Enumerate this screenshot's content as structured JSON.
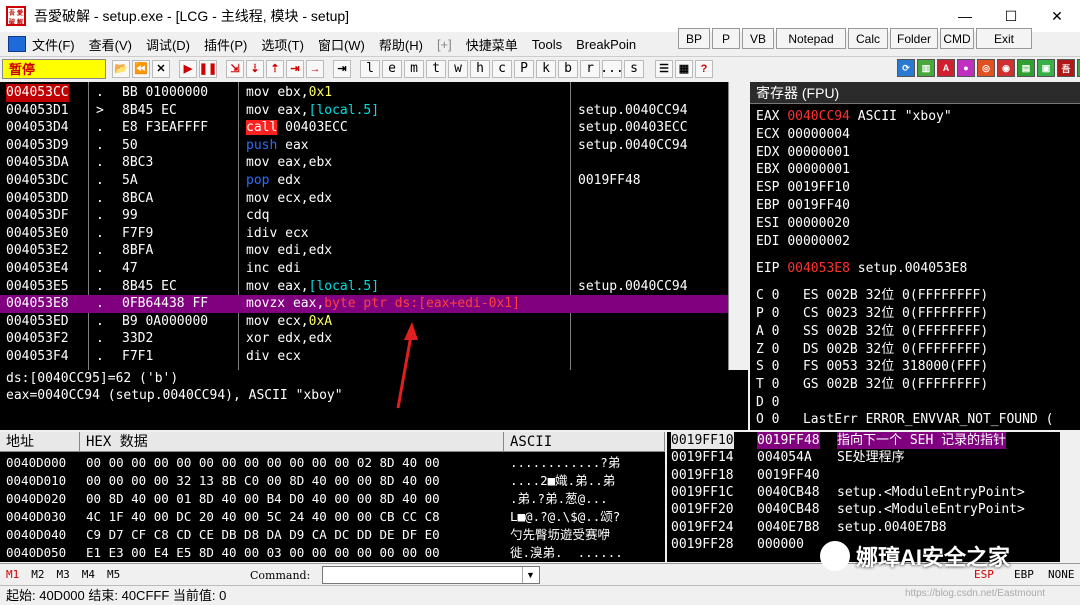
{
  "window": {
    "title": "吾愛破解 - setup.exe - [LCG -  主线程, 模块 - setup]",
    "icon_text": [
      "吾",
      "愛",
      "破",
      "解"
    ]
  },
  "menu": {
    "items": [
      "文件(F)",
      "查看(V)",
      "调试(D)",
      "插件(P)",
      "选项(T)",
      "窗口(W)",
      "帮助(H)",
      "[+]",
      "快捷菜单",
      "Tools",
      "BreakPoin"
    ],
    "quick_buttons": [
      "BP",
      "P",
      "VB",
      "Notepad",
      "Calc",
      "Folder",
      "CMD",
      "Exit"
    ]
  },
  "toolbar": {
    "status": "暂停",
    "letters": [
      "l",
      "e",
      "m",
      "t",
      "w",
      "h",
      "c",
      "P",
      "k",
      "b",
      "r",
      "...",
      "s"
    ],
    "nav_icons": [
      "⏪",
      "✕",
      "▶",
      "❚❚",
      "⇲",
      "⇣",
      "⇡",
      "⇥",
      "→"
    ]
  },
  "disasm": {
    "rows": [
      {
        "addr": "004053CC",
        "mark": ".",
        "hex": "BB 01000000",
        "mn": "mov",
        "ops": "ebx,",
        "imm": "0x1",
        "cmt": ""
      },
      {
        "addr": "004053D1",
        "mark": ">",
        "hex": "8B45 EC",
        "mn": "mov",
        "ops": "eax,",
        "imm": "[local.5]",
        "cmt": "setup.0040CC94"
      },
      {
        "addr": "004053D4",
        "mark": ".",
        "hex": "E8 F3EAFFFF",
        "mn": "call",
        "ops": "00403ECC",
        "imm": "",
        "cmt": "setup.00403ECC"
      },
      {
        "addr": "004053D9",
        "mark": ".",
        "hex": "50",
        "mn": "push",
        "ops": "eax",
        "imm": "",
        "cmt": "setup.0040CC94"
      },
      {
        "addr": "004053DA",
        "mark": ".",
        "hex": "8BC3",
        "mn": "mov",
        "ops": "eax,ebx",
        "imm": "",
        "cmt": ""
      },
      {
        "addr": "004053DC",
        "mark": ".",
        "hex": "5A",
        "mn": "pop",
        "ops": "edx",
        "imm": "",
        "cmt": "0019FF48"
      },
      {
        "addr": "004053DD",
        "mark": ".",
        "hex": "8BCA",
        "mn": "mov",
        "ops": "ecx,edx",
        "imm": "",
        "cmt": ""
      },
      {
        "addr": "004053DF",
        "mark": ".",
        "hex": "99",
        "mn": "cdq",
        "ops": "",
        "imm": "",
        "cmt": ""
      },
      {
        "addr": "004053E0",
        "mark": ".",
        "hex": "F7F9",
        "mn": "idiv",
        "ops": "ecx",
        "imm": "",
        "cmt": ""
      },
      {
        "addr": "004053E2",
        "mark": ".",
        "hex": "8BFA",
        "mn": "mov",
        "ops": "edi,edx",
        "imm": "",
        "cmt": ""
      },
      {
        "addr": "004053E4",
        "mark": ".",
        "hex": "47",
        "mn": "inc",
        "ops": "edi",
        "imm": "",
        "cmt": ""
      },
      {
        "addr": "004053E5",
        "mark": ".",
        "hex": "8B45 EC",
        "mn": "mov",
        "ops": "eax,",
        "imm": "[local.5]",
        "cmt": "setup.0040CC94"
      },
      {
        "addr": "004053E8",
        "mark": ".",
        "hex": "0FB64438 FF",
        "mn": "movzx",
        "ops": "eax,",
        "imm": "byte ptr ds:[eax+edi-0x1]",
        "cmt": ""
      },
      {
        "addr": "004053ED",
        "mark": ".",
        "hex": "B9 0A000000",
        "mn": "mov",
        "ops": "ecx,",
        "imm": "0xA",
        "cmt": ""
      },
      {
        "addr": "004053F2",
        "mark": ".",
        "hex": "33D2",
        "mn": "xor",
        "ops": "edx,edx",
        "imm": "",
        "cmt": ""
      },
      {
        "addr": "004053F4",
        "mark": ".",
        "hex": "F7F1",
        "mn": "div",
        "ops": "ecx",
        "imm": "",
        "cmt": ""
      }
    ]
  },
  "info": {
    "line1": "ds:[0040CC95]=62 ('b')",
    "line2": "eax=0040CC94 (setup.0040CC94), ASCII \"xboy\""
  },
  "registers": {
    "title": "寄存器 (FPU)",
    "gp": [
      {
        "name": "EAX",
        "value": "0040CC94",
        "note": "ASCII \"xboy\"",
        "changed": true
      },
      {
        "name": "ECX",
        "value": "00000004",
        "note": "",
        "changed": false
      },
      {
        "name": "EDX",
        "value": "00000001",
        "note": "",
        "changed": false
      },
      {
        "name": "EBX",
        "value": "00000001",
        "note": "",
        "changed": false
      },
      {
        "name": "ESP",
        "value": "0019FF10",
        "note": "",
        "changed": false
      },
      {
        "name": "EBP",
        "value": "0019FF40",
        "note": "",
        "changed": false
      },
      {
        "name": "ESI",
        "value": "00000020",
        "note": "",
        "changed": false
      },
      {
        "name": "EDI",
        "value": "00000002",
        "note": "",
        "changed": false
      }
    ],
    "eip": {
      "name": "EIP",
      "value": "004053E8",
      "note": "setup.004053E8"
    },
    "flags": [
      "C 0   ES 002B 32位 0(FFFFFFFF)",
      "P 0   CS 0023 32位 0(FFFFFFFF)",
      "A 0   SS 002B 32位 0(FFFFFFFF)",
      "Z 0   DS 002B 32位 0(FFFFFFFF)",
      "S 0   FS 0053 32位 318000(FFF)",
      "T 0   GS 002B 32位 0(FFFFFFFF)",
      "D 0",
      "O 0   LastErr ERROR_ENVVAR_NOT_FOUND ("
    ]
  },
  "dump": {
    "headers": [
      "地址",
      "HEX 数据",
      "ASCII"
    ],
    "rows": [
      {
        "addr": "0040D000",
        "hex": "00 00 00 00 00 00 00 00 00 00 00 00 02 8D 40 00",
        "ascii": "............?弟"
      },
      {
        "addr": "0040D010",
        "hex": "00 00 00 00 32 13 8B C0 00 8D 40 00 00 8D 40 00",
        "ascii": "....2■嬂.弟..弟"
      },
      {
        "addr": "0040D020",
        "hex": "00 8D 40 00 01 8D 40 00 B4 D0 40 00 00 8D 40 00",
        "ascii": ".弟.?弟.葱@..."
      },
      {
        "addr": "0040D030",
        "hex": "4C 1F 40 00 DC 20 40 00 5C 24 40 00 00 CB CC C8",
        "ascii": "L■@.?@.\\$@..颂?"
      },
      {
        "addr": "0040D040",
        "hex": "C9 D7 CF C8 CD CE DB D8 DA D9 CA DC DD DE DF E0",
        "ascii": "勺先臀坜遊受赛咿"
      },
      {
        "addr": "0040D050",
        "hex": "E1 E3 00 E4 E5 8D 40 00 03 00 00 00 00 00 00 00",
        "ascii": "徙.溴弟.  ......"
      }
    ]
  },
  "stack": {
    "rows": [
      {
        "addr": "0019FF10",
        "value": "0019FF48",
        "comment": "指向下一个 SEH 记录的指针",
        "hl": true
      },
      {
        "addr": "0019FF14",
        "value": "004054A",
        "comment": "SE处理程序",
        "hl": false
      },
      {
        "addr": "0019FF18",
        "value": "0019FF40",
        "comment": "",
        "hl": false
      },
      {
        "addr": "0019FF1C",
        "value": "0040CB48",
        "comment": "setup.<ModuleEntryPoint>",
        "hl": false
      },
      {
        "addr": "0019FF20",
        "value": "0040CB48",
        "comment": "setup.<ModuleEntryPoint>",
        "hl": false
      },
      {
        "addr": "0019FF24",
        "value": "0040E7B8",
        "comment": "setup.0040E7B8",
        "hl": false
      },
      {
        "addr": "0019FF28",
        "value": "000000",
        "comment": "",
        "hl": false
      }
    ]
  },
  "cmdbar": {
    "tabs": [
      "M1",
      "M2",
      "M3",
      "M4",
      "M5"
    ],
    "label": "Command:",
    "right": [
      "ESP",
      "EBP",
      "NONE"
    ]
  },
  "statusbar": {
    "text": "起始: 40D000 结束: 40CFFF 当前值: 0"
  },
  "watermark": {
    "text": "娜璋AI安全之家",
    "url": "https://blog.csdn.net/Eastmount"
  },
  "colors": {
    "selected_row": "#800080",
    "current_addr": "#c00000",
    "status_bg": "#ffff00"
  }
}
